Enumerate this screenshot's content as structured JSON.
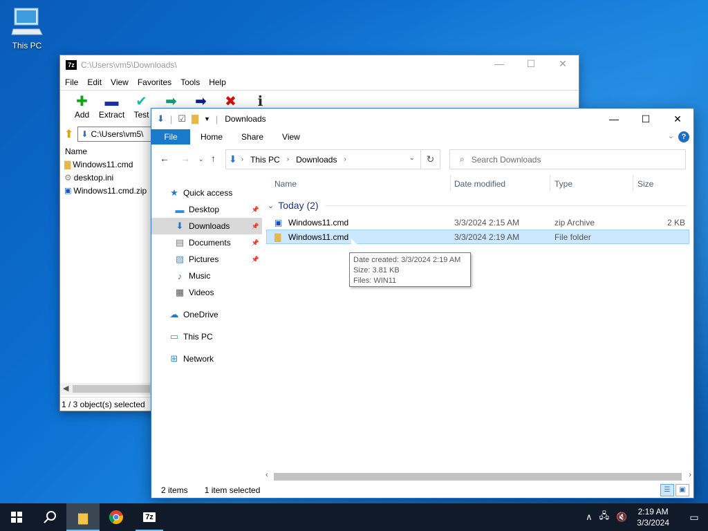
{
  "desktop": {
    "icon_label": "This PC"
  },
  "sevenzip": {
    "title": "C:\\Users\\vm5\\Downloads\\",
    "menu": [
      "File",
      "Edit",
      "View",
      "Favorites",
      "Tools",
      "Help"
    ],
    "toolbar": {
      "add": "Add",
      "extract": "Extract",
      "test": "Test"
    },
    "address": "C:\\Users\\vm5\\",
    "column_name": "Name",
    "files": [
      {
        "name": "Windows11.cmd",
        "icon": "folder-icon"
      },
      {
        "name": "desktop.ini",
        "icon": "settings-file-icon"
      },
      {
        "name": "Windows11.cmd.zip",
        "icon": "zip-icon"
      }
    ],
    "status": "1 / 3 object(s) selected"
  },
  "explorer": {
    "title": "Downloads",
    "ribbon": {
      "file": "File",
      "home": "Home",
      "share": "Share",
      "view": "View"
    },
    "breadcrumb": [
      "This PC",
      "Downloads"
    ],
    "search_placeholder": "Search Downloads",
    "sidebar": {
      "quick_access": "Quick access",
      "desktop": "Desktop",
      "downloads": "Downloads",
      "documents": "Documents",
      "pictures": "Pictures",
      "music": "Music",
      "videos": "Videos",
      "onedrive": "OneDrive",
      "thispc": "This PC",
      "network": "Network"
    },
    "columns": {
      "name": "Name",
      "date": "Date modified",
      "type": "Type",
      "size": "Size"
    },
    "group": "Today (2)",
    "rows": [
      {
        "name": "Windows11.cmd",
        "date": "3/3/2024 2:15 AM",
        "type": "zip Archive",
        "size": "2 KB"
      },
      {
        "name": "Windows11.cmd",
        "date": "3/3/2024 2:19 AM",
        "type": "File folder",
        "size": ""
      }
    ],
    "tooltip": {
      "created": "Date created: 3/3/2024 2:19 AM",
      "size": "Size: 3.81 KB",
      "files": "Files: WIN11"
    },
    "status": {
      "items": "2 items",
      "selected": "1 item selected"
    }
  },
  "taskbar": {
    "time": "2:19 AM",
    "date": "3/3/2024",
    "sevenzip_label": "7z"
  }
}
